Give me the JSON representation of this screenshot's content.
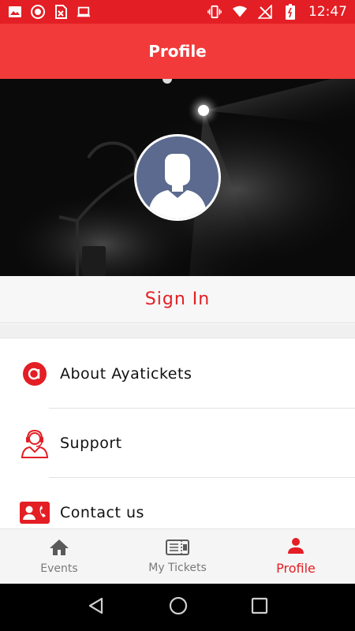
{
  "status_bar": {
    "time": "12:47",
    "left_icons": [
      "image-icon",
      "record-icon",
      "sim-x-icon",
      "laptop-icon"
    ],
    "right_icons": [
      "vibrate-icon",
      "wifi-icon",
      "no-signal-icon",
      "battery-icon"
    ]
  },
  "app_bar": {
    "title": "Profile"
  },
  "hero": {
    "avatar_icon": "default-user-avatar-icon"
  },
  "signin": {
    "label": "Sign In"
  },
  "menu": {
    "items": [
      {
        "label": "About Ayatickets",
        "icon": "ayatickets-logo-icon"
      },
      {
        "label": "Support",
        "icon": "support-agent-icon"
      },
      {
        "label": "Contact us",
        "icon": "contact-card-icon"
      }
    ]
  },
  "bottom_nav": {
    "tabs": [
      {
        "label": "Events",
        "icon": "home-icon",
        "active": false
      },
      {
        "label": "My Tickets",
        "icon": "ticket-icon",
        "active": false
      },
      {
        "label": "Profile",
        "icon": "person-icon",
        "active": true
      }
    ]
  },
  "colors": {
    "status_bar": "#e31e24",
    "app_bar": "#f23a3a",
    "accent": "#e31e24",
    "avatar_bg": "#5b6a8e"
  }
}
